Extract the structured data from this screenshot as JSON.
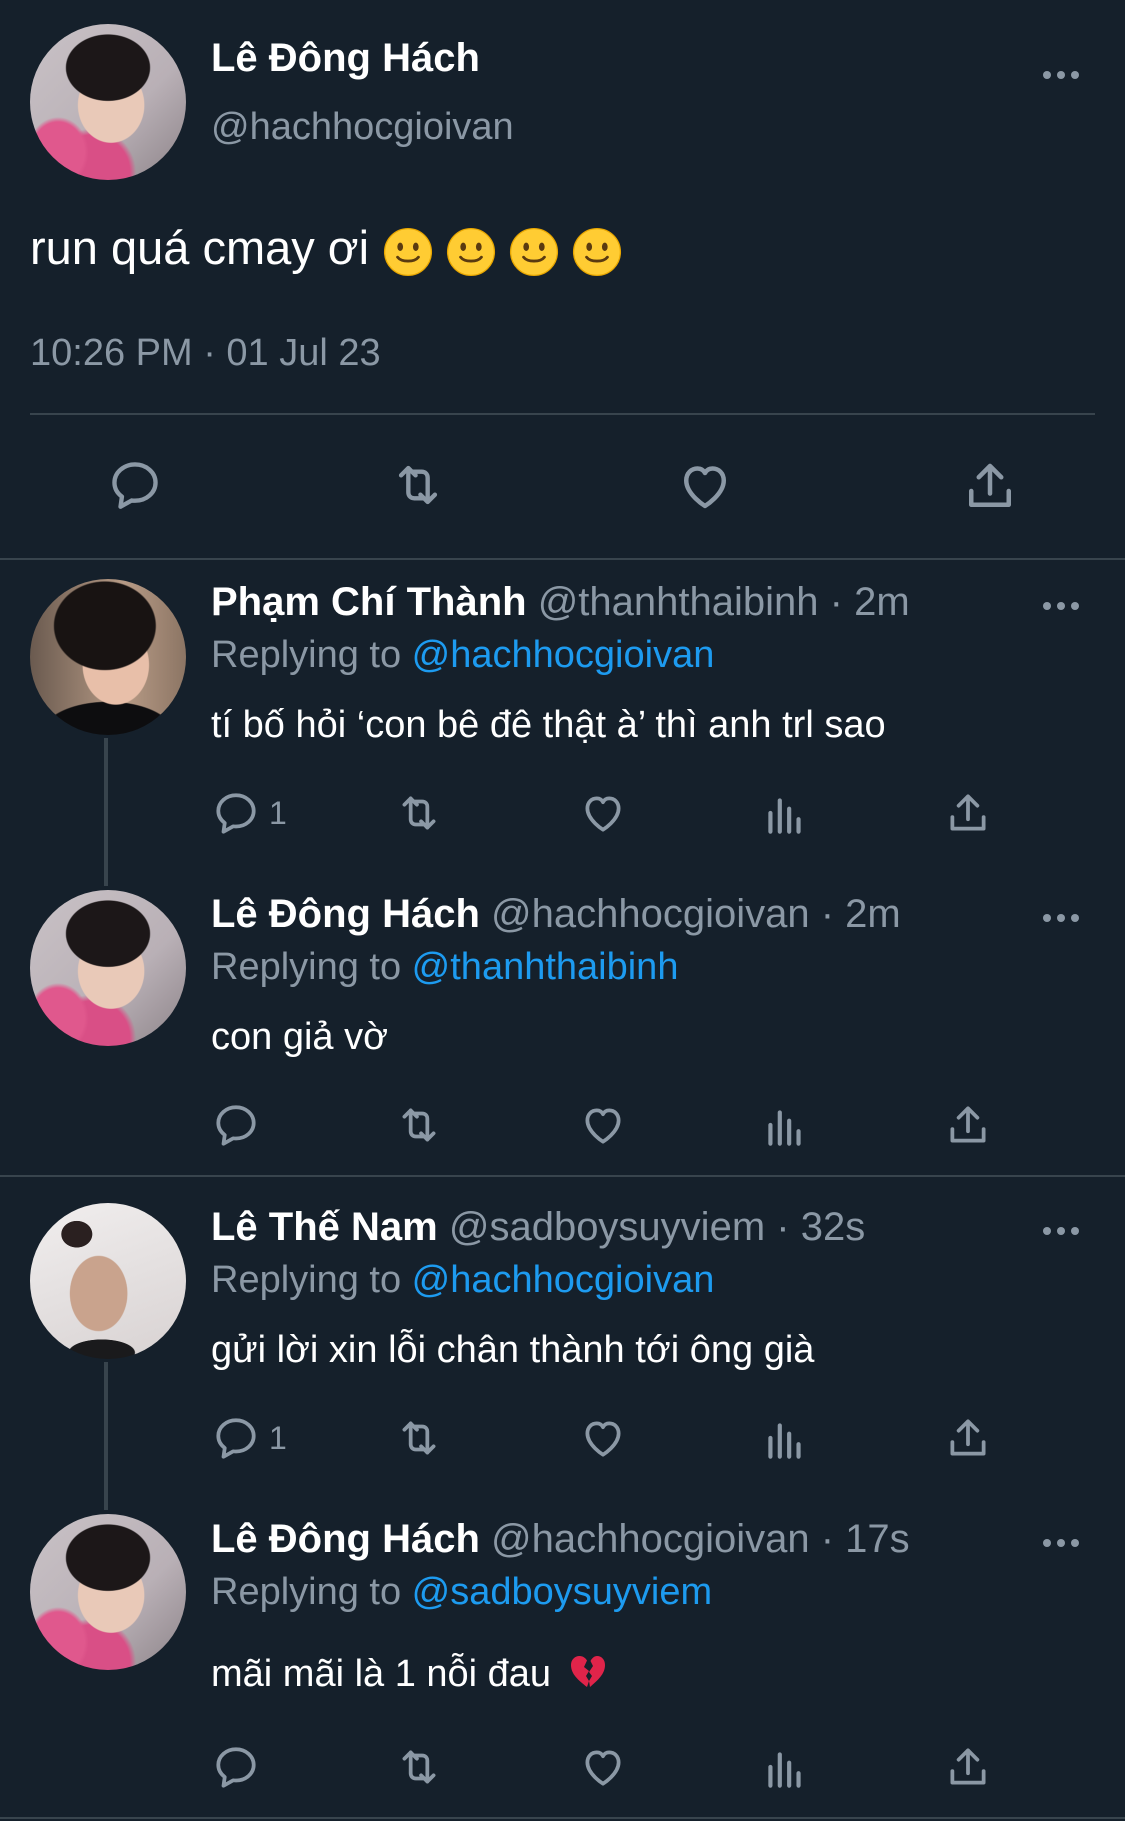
{
  "main_tweet": {
    "name": "Lê Đông Hách",
    "handle": "@hachhocgioivan",
    "text": "run quá cmay ơi",
    "emojis": [
      "slightly-smiling-face",
      "slightly-smiling-face",
      "slightly-smiling-face",
      "slightly-smiling-face"
    ],
    "timestamp": "10:26 PM · 01 Jul 23"
  },
  "replies": [
    {
      "name": "Phạm Chí Thành",
      "handle": "@thanhthaibinh",
      "time": "· 2m",
      "replying_prefix": "Replying to ",
      "replying_to": "@hachhocgioivan",
      "text": "tí bố hỏi ‘con bê đê thật à’ thì anh trl sao",
      "reply_count": "1"
    },
    {
      "name": "Lê Đông Hách",
      "handle": "@hachhocgioivan",
      "time": "· 2m",
      "replying_prefix": "Replying to ",
      "replying_to": "@thanhthaibinh",
      "text": "con giả vờ",
      "reply_count": ""
    },
    {
      "name": "Lê Thế Nam",
      "handle": "@sadboysuyviem",
      "time": "· 32s",
      "replying_prefix": "Replying to ",
      "replying_to": "@hachhocgioivan",
      "text": "gửi lời xin lỗi chân thành tới ông già",
      "reply_count": "1"
    },
    {
      "name": "Lê Đông Hách",
      "handle": "@hachhocgioivan",
      "time": "· 17s",
      "replying_prefix": "Replying to ",
      "replying_to": "@sadboysuyviem",
      "text": "mãi mãi là 1 nỗi đau",
      "text_emoji": "broken-heart",
      "reply_count": ""
    }
  ],
  "colors": {
    "background": "#15202b",
    "text": "#ffffff",
    "muted": "#8b98a5",
    "link": "#1d9bf0",
    "divider": "#38444d"
  },
  "icons": [
    "more-icon",
    "reply-icon",
    "retweet-icon",
    "like-icon",
    "views-icon",
    "share-icon"
  ]
}
